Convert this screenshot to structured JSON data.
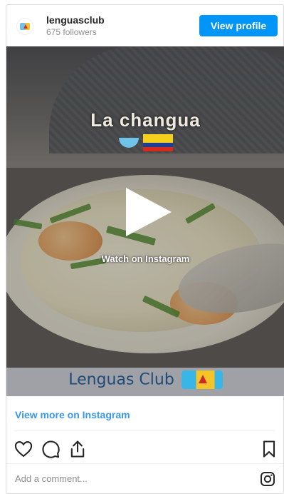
{
  "header": {
    "username": "lenguasclub",
    "followers": "675 followers",
    "view_profile": "View profile"
  },
  "media": {
    "title": "La changua",
    "watch_label": "Watch on Instagram",
    "brand": "Lenguas Club"
  },
  "footer": {
    "view_more": "View more on Instagram",
    "comment_placeholder": "Add a comment..."
  },
  "colors": {
    "accent": "#0095f6",
    "link": "#3897f0"
  },
  "icons": [
    "heart-icon",
    "comment-icon",
    "share-icon",
    "bookmark-icon",
    "instagram-icon"
  ]
}
